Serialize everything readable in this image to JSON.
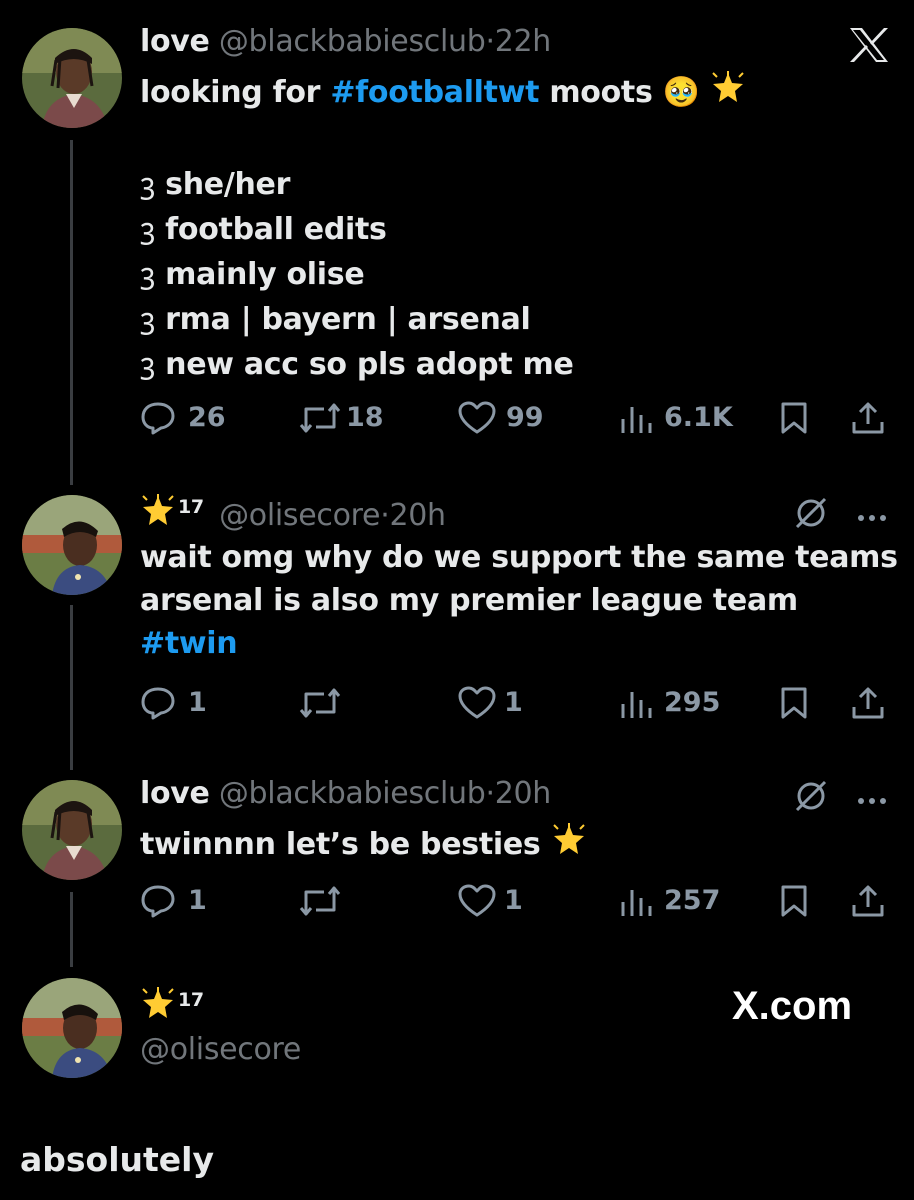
{
  "tweets": [
    {
      "display_name": "love",
      "handle": "@blackbabiesclub",
      "time": "22h",
      "text_prefix": "looking for ",
      "hashtag": "#footballtwt",
      "text_suffix": " moots",
      "emoji": "🥹",
      "list_bullet": "🎀",
      "list": [
        "she/her",
        "football edits",
        "mainly olise",
        "rma | bayern | arsenal",
        "new acc so pls adopt me"
      ],
      "replies": "26",
      "reposts": "18",
      "likes": "99",
      "views": "6.1K"
    },
    {
      "badge_number": "17",
      "handle": "@olisecore",
      "time": "20h",
      "line1": "wait omg why do we support the same teams",
      "line2": "arsenal is also my premier league team",
      "hashtag": "#twin",
      "replies": "1",
      "reposts": "",
      "likes": "1",
      "views": "295"
    },
    {
      "display_name": "love",
      "handle": "@blackbabiesclub",
      "time": "20h",
      "text": "twinnnn let’s be besties",
      "replies": "1",
      "reposts": "",
      "likes": "1",
      "views": "257"
    },
    {
      "badge_number": "17",
      "handle": "@olisecore"
    }
  ],
  "separator": "·",
  "watermark": "X.com",
  "caption": "absolutely",
  "colors": {
    "background": "#000000",
    "text": "#e7e9ea",
    "muted": "#8b98a5",
    "link": "#1d9bf0"
  }
}
